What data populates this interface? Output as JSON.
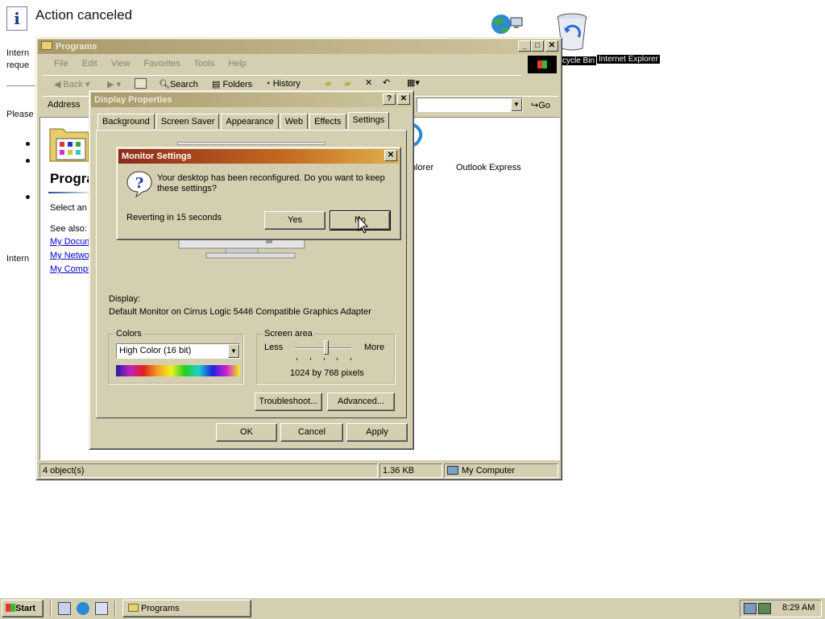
{
  "background_page": {
    "title": "Action canceled",
    "fragments": [
      "Intern",
      "reque",
      "Please",
      "Intern"
    ]
  },
  "desktop": {
    "icons": [
      {
        "label": "cycle Bin",
        "icon": "recycle-bin-icon"
      },
      {
        "label": "Internet Explorer",
        "icon": "internet-explorer-icon"
      }
    ]
  },
  "programs_window": {
    "title": "Programs",
    "menu": [
      "File",
      "Edit",
      "View",
      "Favorites",
      "Tools",
      "Help"
    ],
    "toolbar": {
      "back": "Back",
      "search": "Search",
      "folders": "Folders",
      "history": "History"
    },
    "address_label": "Address",
    "go_label": "Go",
    "left_pane": {
      "heading": "Progra",
      "select_text": "Select an",
      "see_also": "See also:",
      "links": [
        "My Docum",
        "My Netwo",
        "My Compu"
      ]
    },
    "items": [
      {
        "label": "plorer"
      },
      {
        "label": "Outlook Express"
      }
    ],
    "status": {
      "objects": "4 object(s)",
      "size": "1.36 KB",
      "location": "My Computer"
    }
  },
  "display_properties": {
    "title": "Display Properties",
    "tabs": [
      "Background",
      "Screen Saver",
      "Appearance",
      "Web",
      "Effects",
      "Settings"
    ],
    "active_tab": "Settings",
    "display_label": "Display:",
    "display_value": "Default Monitor on Cirrus Logic 5446 Compatible Graphics Adapter",
    "colors_group": "Colors",
    "colors_value": "High Color (16 bit)",
    "screen_area_group": "Screen area",
    "less": "Less",
    "more": "More",
    "resolution": "1024 by 768 pixels",
    "resolution_slider_fraction": 0.55,
    "troubleshoot": "Troubleshoot...",
    "advanced": "Advanced...",
    "ok": "OK",
    "cancel": "Cancel",
    "apply": "Apply"
  },
  "monitor_settings": {
    "title": "Monitor Settings",
    "message": "Your desktop has been reconfigured.  Do you want to keep these settings?",
    "countdown": "Reverting in 15 seconds",
    "yes": "Yes",
    "no": "No"
  },
  "taskbar": {
    "start": "Start",
    "task": "Programs",
    "clock": "8:29 AM"
  },
  "colors": {
    "active_title_start": "#8e2a18",
    "active_title_end": "#e2b04a",
    "window_face": "#d4cfb0",
    "desktop": "#ffffff"
  }
}
